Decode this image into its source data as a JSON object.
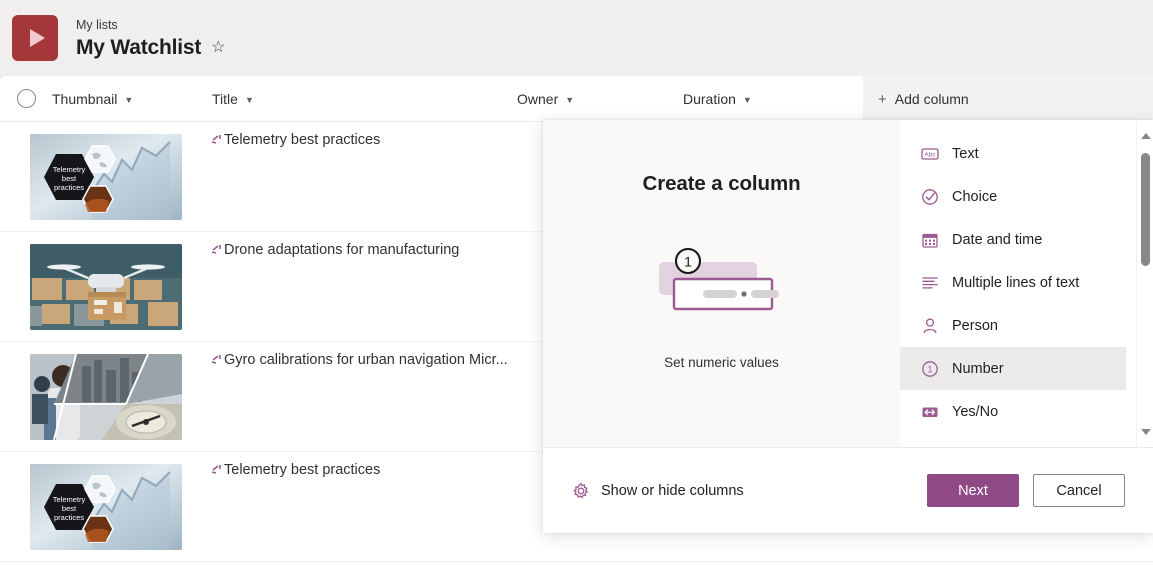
{
  "header": {
    "breadcrumb": "My lists",
    "title": "My Watchlist",
    "favorite_icon": "star-icon",
    "list_icon": "play-icon",
    "list_icon_color": "#a4373a"
  },
  "list": {
    "select_all_name": "select-all-circle",
    "columns": [
      {
        "label": "Thumbnail",
        "sortable": true
      },
      {
        "label": "Title",
        "sortable": true
      },
      {
        "label": "Owner",
        "sortable": true
      },
      {
        "label": "Duration",
        "sortable": true
      }
    ],
    "add_column_label": "Add column",
    "add_column_icon": "plus-icon",
    "rows": [
      {
        "title": "Telemetry best practices",
        "thumbnail": "telemetry-hexagons-chart",
        "new_marker": true
      },
      {
        "title": "Drone adaptations for manufacturing",
        "thumbnail": "drone-carrying-box-warehouse",
        "new_marker": true
      },
      {
        "title": "Gyro calibrations for urban navigation Micr...",
        "thumbnail": "engineer-city-gyroscope-collage",
        "new_marker": true
      },
      {
        "title": "Telemetry best practices",
        "thumbnail": "telemetry-hexagons-chart",
        "new_marker": true
      }
    ]
  },
  "dialog": {
    "heading": "Create a column",
    "illustration_caption": "Set numeric values",
    "illustration_badge": "1",
    "accent_color": "#8f4a86",
    "types": [
      {
        "label": "Text",
        "icon": "abc-text-icon",
        "selected": false
      },
      {
        "label": "Choice",
        "icon": "check-circle-icon",
        "selected": false
      },
      {
        "label": "Date and time",
        "icon": "calendar-icon",
        "selected": false
      },
      {
        "label": "Multiple lines of text",
        "icon": "lines-of-text-icon",
        "selected": false
      },
      {
        "label": "Person",
        "icon": "person-icon",
        "selected": false
      },
      {
        "label": "Number",
        "icon": "number-one-circle-icon",
        "selected": true
      },
      {
        "label": "Yes/No",
        "icon": "toggle-yes-no-icon",
        "selected": false
      }
    ],
    "footer": {
      "show_hide_label": "Show or hide columns",
      "show_hide_icon": "gear-icon",
      "next_label": "Next",
      "cancel_label": "Cancel"
    },
    "scrollbar": {
      "up_icon": "scroll-up-arrow-icon",
      "down_icon": "scroll-down-arrow-icon"
    }
  }
}
